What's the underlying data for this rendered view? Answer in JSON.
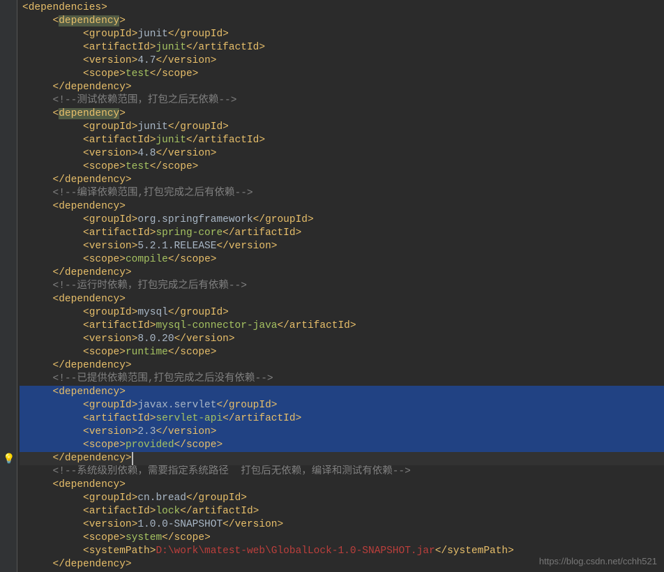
{
  "watermark": "https://blog.csdn.net/cchh521",
  "lines": [
    {
      "indent": 0,
      "cls": "",
      "tokens": [
        {
          "c": "t",
          "t": "<dependencies>"
        }
      ]
    },
    {
      "indent": 1,
      "cls": "",
      "tokens": [
        {
          "c": "t",
          "t": "<"
        },
        {
          "c": "t hl",
          "t": "dependency"
        },
        {
          "c": "t",
          "t": ">"
        }
      ]
    },
    {
      "indent": 2,
      "cls": "",
      "tokens": [
        {
          "c": "t",
          "t": "<groupId>"
        },
        {
          "c": "av",
          "t": "junit"
        },
        {
          "c": "t",
          "t": "</groupId>"
        }
      ]
    },
    {
      "indent": 2,
      "cls": "",
      "tokens": [
        {
          "c": "t",
          "t": "<artifactId>"
        },
        {
          "c": "tx",
          "t": "junit"
        },
        {
          "c": "t",
          "t": "</artifactId>"
        }
      ]
    },
    {
      "indent": 2,
      "cls": "",
      "tokens": [
        {
          "c": "t",
          "t": "<version>"
        },
        {
          "c": "av",
          "t": "4.7"
        },
        {
          "c": "t",
          "t": "</version>"
        }
      ]
    },
    {
      "indent": 2,
      "cls": "",
      "tokens": [
        {
          "c": "t",
          "t": "<scope>"
        },
        {
          "c": "tx",
          "t": "test"
        },
        {
          "c": "t",
          "t": "</scope>"
        }
      ]
    },
    {
      "indent": 1,
      "cls": "",
      "tokens": [
        {
          "c": "t",
          "t": "</dependency>"
        }
      ]
    },
    {
      "indent": 1,
      "cls": "",
      "tokens": [
        {
          "c": "cm",
          "t": "<!--测试依赖范围，打包之后无依赖-->"
        }
      ]
    },
    {
      "indent": 1,
      "cls": "",
      "tokens": [
        {
          "c": "t",
          "t": "<"
        },
        {
          "c": "t hl",
          "t": "dependency"
        },
        {
          "c": "t",
          "t": ">"
        }
      ]
    },
    {
      "indent": 2,
      "cls": "",
      "tokens": [
        {
          "c": "t",
          "t": "<groupId>"
        },
        {
          "c": "av",
          "t": "junit"
        },
        {
          "c": "t",
          "t": "</groupId>"
        }
      ]
    },
    {
      "indent": 2,
      "cls": "",
      "tokens": [
        {
          "c": "t",
          "t": "<artifactId>"
        },
        {
          "c": "tx",
          "t": "junit"
        },
        {
          "c": "t",
          "t": "</artifactId>"
        }
      ]
    },
    {
      "indent": 2,
      "cls": "",
      "tokens": [
        {
          "c": "t",
          "t": "<version>"
        },
        {
          "c": "av",
          "t": "4.8"
        },
        {
          "c": "t",
          "t": "</version>"
        }
      ]
    },
    {
      "indent": 2,
      "cls": "",
      "tokens": [
        {
          "c": "t",
          "t": "<scope>"
        },
        {
          "c": "tx",
          "t": "test"
        },
        {
          "c": "t",
          "t": "</scope>"
        }
      ]
    },
    {
      "indent": 1,
      "cls": "",
      "tokens": [
        {
          "c": "t",
          "t": "</dependency>"
        }
      ]
    },
    {
      "indent": 1,
      "cls": "",
      "tokens": [
        {
          "c": "cm",
          "t": "<!--编译依赖范围,打包完成之后有依赖-->"
        }
      ]
    },
    {
      "indent": 1,
      "cls": "",
      "tokens": [
        {
          "c": "t",
          "t": "<dependency>"
        }
      ]
    },
    {
      "indent": 2,
      "cls": "",
      "tokens": [
        {
          "c": "t",
          "t": "<groupId>"
        },
        {
          "c": "av",
          "t": "org.springframework"
        },
        {
          "c": "t",
          "t": "</groupId>"
        }
      ]
    },
    {
      "indent": 2,
      "cls": "",
      "tokens": [
        {
          "c": "t",
          "t": "<artifactId>"
        },
        {
          "c": "tx",
          "t": "spring-core"
        },
        {
          "c": "t",
          "t": "</artifactId>"
        }
      ]
    },
    {
      "indent": 2,
      "cls": "",
      "tokens": [
        {
          "c": "t",
          "t": "<version>"
        },
        {
          "c": "av",
          "t": "5.2.1.RELEASE"
        },
        {
          "c": "t",
          "t": "</version>"
        }
      ]
    },
    {
      "indent": 2,
      "cls": "",
      "tokens": [
        {
          "c": "t",
          "t": "<scope>"
        },
        {
          "c": "tx",
          "t": "compile"
        },
        {
          "c": "t",
          "t": "</scope>"
        }
      ]
    },
    {
      "indent": 1,
      "cls": "",
      "tokens": [
        {
          "c": "t",
          "t": "</dependency>"
        }
      ]
    },
    {
      "indent": 1,
      "cls": "",
      "tokens": [
        {
          "c": "cm",
          "t": "<!--运行时依赖，打包完成之后有依赖-->"
        }
      ]
    },
    {
      "indent": 1,
      "cls": "",
      "tokens": [
        {
          "c": "t",
          "t": "<dependency>"
        }
      ]
    },
    {
      "indent": 2,
      "cls": "",
      "tokens": [
        {
          "c": "t",
          "t": "<groupId>"
        },
        {
          "c": "av",
          "t": "mysql"
        },
        {
          "c": "t",
          "t": "</groupId>"
        }
      ]
    },
    {
      "indent": 2,
      "cls": "",
      "tokens": [
        {
          "c": "t",
          "t": "<artifactId>"
        },
        {
          "c": "tx",
          "t": "mysql-connector-java"
        },
        {
          "c": "t",
          "t": "</artifactId>"
        }
      ]
    },
    {
      "indent": 2,
      "cls": "",
      "tokens": [
        {
          "c": "t",
          "t": "<version>"
        },
        {
          "c": "av",
          "t": "8.0.20"
        },
        {
          "c": "t",
          "t": "</version>"
        }
      ]
    },
    {
      "indent": 2,
      "cls": "",
      "tokens": [
        {
          "c": "t",
          "t": "<scope>"
        },
        {
          "c": "tx",
          "t": "runtime"
        },
        {
          "c": "t",
          "t": "</scope>"
        }
      ]
    },
    {
      "indent": 1,
      "cls": "",
      "tokens": [
        {
          "c": "t",
          "t": "</dependency>"
        }
      ]
    },
    {
      "indent": 1,
      "cls": "",
      "tokens": [
        {
          "c": "cm",
          "t": "<!--已提供依赖范围,打包完成之后没有依赖-->"
        }
      ]
    },
    {
      "indent": 1,
      "cls": "selected",
      "tokens": [
        {
          "c": "t",
          "t": "<dependency>"
        }
      ]
    },
    {
      "indent": 2,
      "cls": "selected",
      "tokens": [
        {
          "c": "t",
          "t": "<groupId>"
        },
        {
          "c": "av",
          "t": "javax.servlet"
        },
        {
          "c": "t",
          "t": "</groupId>"
        }
      ]
    },
    {
      "indent": 2,
      "cls": "selected",
      "tokens": [
        {
          "c": "t",
          "t": "<artifactId>"
        },
        {
          "c": "tx",
          "t": "servlet-api"
        },
        {
          "c": "t",
          "t": "</artifactId>"
        }
      ]
    },
    {
      "indent": 2,
      "cls": "selected",
      "tokens": [
        {
          "c": "t",
          "t": "<version>"
        },
        {
          "c": "av",
          "t": "2.3"
        },
        {
          "c": "t",
          "t": "</version>"
        }
      ]
    },
    {
      "indent": 2,
      "cls": "selected",
      "tokens": [
        {
          "c": "t",
          "t": "<scope>"
        },
        {
          "c": "tx",
          "t": "provided"
        },
        {
          "c": "t",
          "t": "</scope>"
        }
      ]
    },
    {
      "indent": 1,
      "cls": "caret",
      "tokens": [
        {
          "c": "t",
          "t": "</dependency>"
        }
      ],
      "caret": true
    },
    {
      "indent": 1,
      "cls": "",
      "tokens": [
        {
          "c": "cm",
          "t": "<!--系统级别依赖，需要指定系统路径  打包后无依赖，编译和测试有依赖-->"
        }
      ]
    },
    {
      "indent": 1,
      "cls": "",
      "tokens": [
        {
          "c": "t",
          "t": "<dependency>"
        }
      ]
    },
    {
      "indent": 2,
      "cls": "",
      "tokens": [
        {
          "c": "t",
          "t": "<groupId>"
        },
        {
          "c": "av",
          "t": "cn.bread"
        },
        {
          "c": "t",
          "t": "</groupId>"
        }
      ]
    },
    {
      "indent": 2,
      "cls": "",
      "tokens": [
        {
          "c": "t",
          "t": "<artifactId>"
        },
        {
          "c": "tx",
          "t": "lock"
        },
        {
          "c": "t",
          "t": "</artifactId>"
        }
      ]
    },
    {
      "indent": 2,
      "cls": "",
      "tokens": [
        {
          "c": "t",
          "t": "<version>"
        },
        {
          "c": "av",
          "t": "1.0.0-SNAPSHOT"
        },
        {
          "c": "t",
          "t": "</version>"
        }
      ]
    },
    {
      "indent": 2,
      "cls": "",
      "tokens": [
        {
          "c": "t",
          "t": "<scope>"
        },
        {
          "c": "tx",
          "t": "system"
        },
        {
          "c": "t",
          "t": "</scope>"
        }
      ]
    },
    {
      "indent": 2,
      "cls": "",
      "tokens": [
        {
          "c": "t",
          "t": "<systemPath>"
        },
        {
          "c": "err",
          "t": "D:\\work\\matest-web\\GlobalLock-1.0-SNAPSHOT.jar"
        },
        {
          "c": "t",
          "t": "</systemPath>"
        }
      ]
    },
    {
      "indent": 1,
      "cls": "",
      "tokens": [
        {
          "c": "t",
          "t": "</dependency>"
        }
      ]
    }
  ]
}
